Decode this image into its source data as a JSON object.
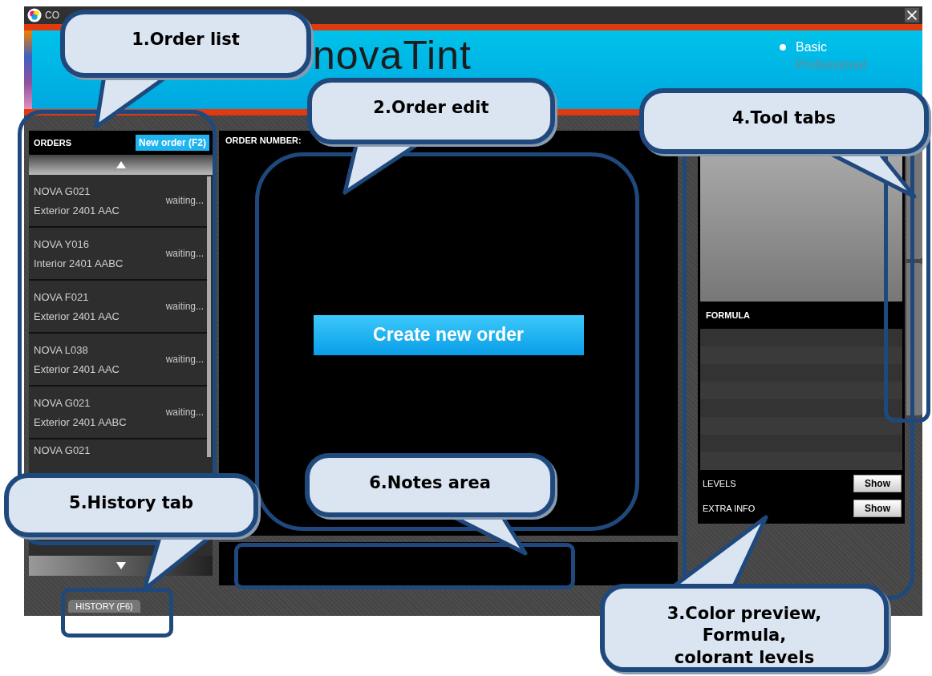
{
  "window": {
    "title": "CO"
  },
  "header": {
    "logo_text": "novaTint",
    "modes": [
      {
        "label": "Basic",
        "selected": true
      },
      {
        "label": "Professional",
        "selected": false
      }
    ]
  },
  "orders_panel": {
    "title": "ORDERS",
    "new_button": "New order (F2)",
    "orders": [
      {
        "name": "NOVA G021",
        "product": "Exterior 2401 AAC",
        "status": "waiting..."
      },
      {
        "name": "NOVA Y016",
        "product": "Interior 2401 AABC",
        "status": "waiting..."
      },
      {
        "name": "NOVA F021",
        "product": "Exterior 2401 AAC",
        "status": "waiting..."
      },
      {
        "name": "NOVA L038",
        "product": "Exterior 2401 AAC",
        "status": "waiting..."
      },
      {
        "name": "NOVA G021",
        "product": "Exterior 2401 AABC",
        "status": "waiting..."
      },
      {
        "name": "NOVA G021"
      }
    ]
  },
  "history_tab": "HISTORY (F6)",
  "order_edit": {
    "label": "ORDER NUMBER:",
    "create_button": "Create new order"
  },
  "tools_panel": {
    "formula_title": "FORMULA",
    "rows": [
      {
        "label": "LEVELS",
        "button": "Show"
      },
      {
        "label": "EXTRA INFO",
        "button": "Show"
      }
    ]
  },
  "callouts": [
    {
      "lines": [
        "1.Order list"
      ]
    },
    {
      "lines": [
        "2.Order edit"
      ]
    },
    {
      "lines": [
        "4.Tool tabs"
      ]
    },
    {
      "lines": [
        "5.History tab"
      ]
    },
    {
      "lines": [
        "6.Notes area"
      ]
    },
    {
      "lines": [
        "3.Color preview,",
        "Formula,",
        "colorant levels"
      ]
    }
  ]
}
